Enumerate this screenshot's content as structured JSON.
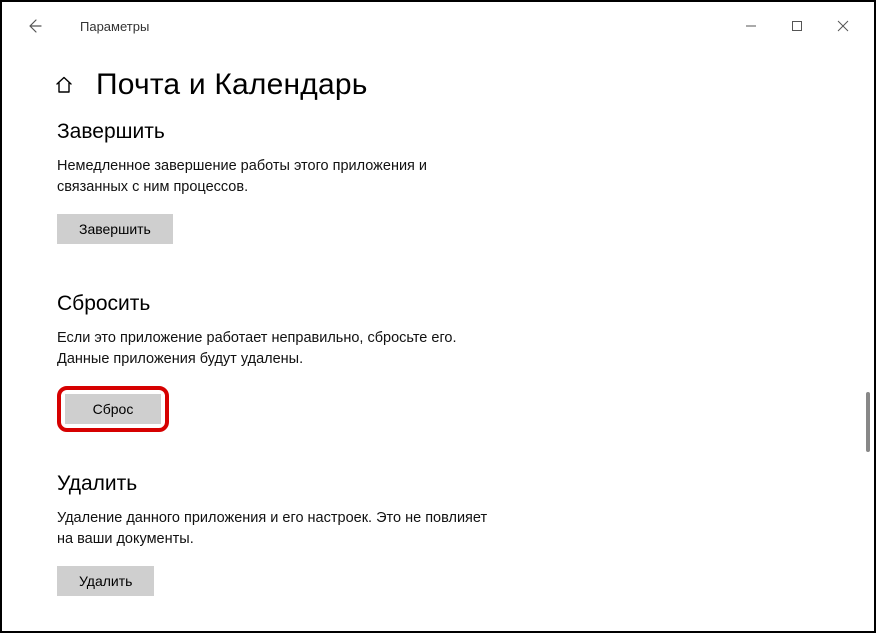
{
  "window": {
    "title": "Параметры"
  },
  "page": {
    "title": "Почта и Календарь"
  },
  "sections": {
    "terminate": {
      "heading": "Завершить",
      "desc": "Немедленное завершение работы этого приложения и связанных с ним процессов.",
      "button": "Завершить"
    },
    "reset": {
      "heading": "Сбросить",
      "desc": "Если это приложение работает неправильно, сбросьте его. Данные приложения будут удалены.",
      "button": "Сброс"
    },
    "uninstall": {
      "heading": "Удалить",
      "desc": "Удаление данного приложения и его настроек. Это не повлияет на ваши документы.",
      "button": "Удалить"
    }
  }
}
